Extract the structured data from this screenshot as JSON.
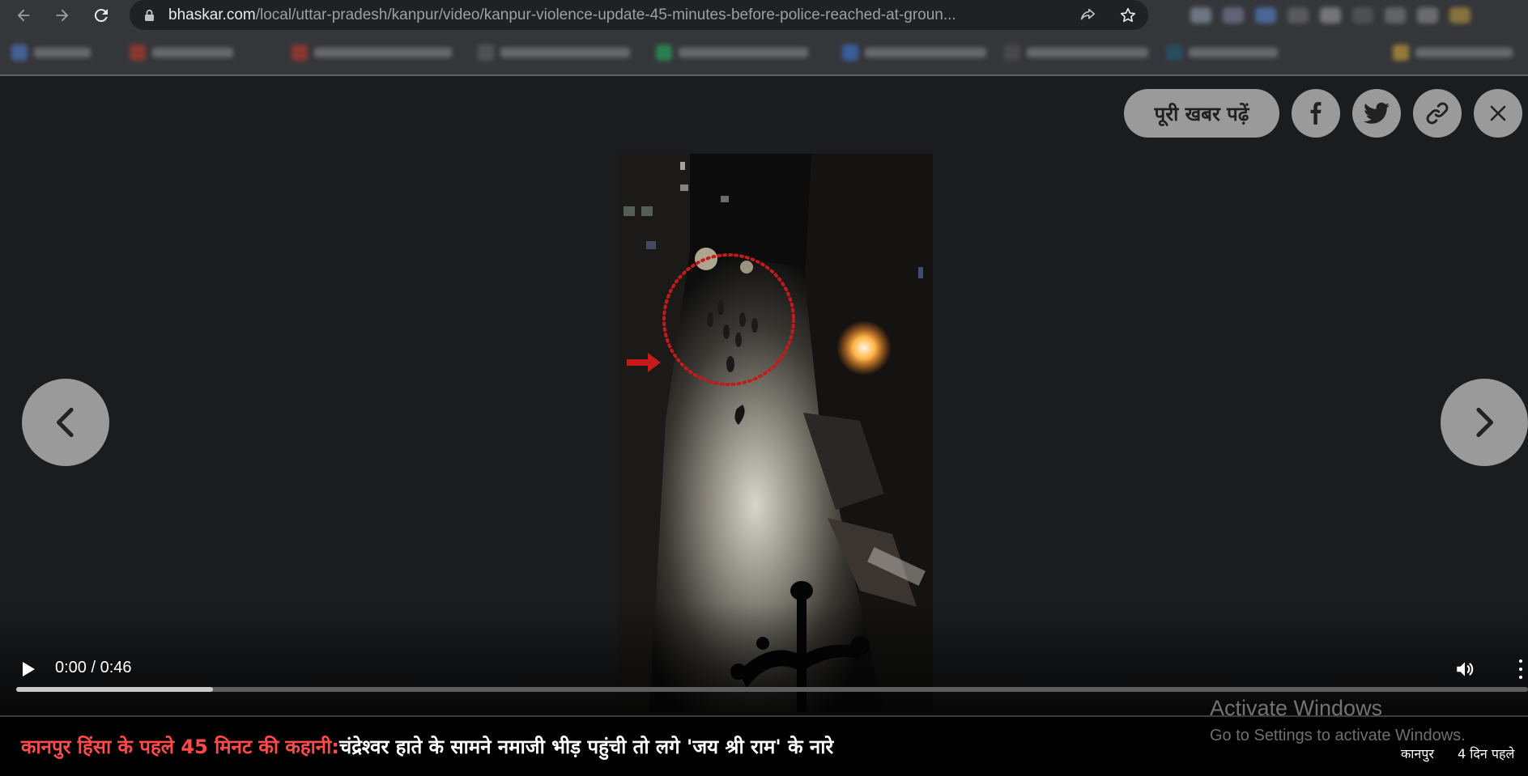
{
  "browser": {
    "url_host": "bhaskar.com",
    "url_path": "/local/uttar-pradesh/kanpur/video/kanpur-violence-update-45-minutes-before-police-reached-at-groun..."
  },
  "overlay": {
    "read_full_story_label": "पूरी खबर पढ़ें"
  },
  "player": {
    "time_display": "0:00 / 0:46",
    "buffered_fraction": 0.13
  },
  "caption": {
    "kicker": "कानपुर हिंसा के पहले 45 मिनट की कहानी:",
    "headline": "चंद्रेश्वर हाते के सामने नमाजी भीड़ पहुंची तो लगे 'जय श्री राम' के नारे",
    "location": "कानपुर",
    "time_ago": "4 दिन पहले"
  },
  "watermark": {
    "title": "Activate Windows",
    "subtitle": "Go to Settings to activate Windows."
  },
  "colors": {
    "kicker_red": "#ff4a4a",
    "button_grey": "#9a9a9a",
    "stage_bg": "#1b1c1e"
  },
  "icons": [
    "back-arrow-icon",
    "forward-arrow-icon",
    "reload-icon",
    "lock-icon",
    "share-icon",
    "star-icon",
    "facebook-icon",
    "twitter-icon",
    "link-icon",
    "close-icon",
    "chevron-left-icon",
    "chevron-right-icon",
    "play-icon",
    "volume-icon",
    "more-vert-icon"
  ]
}
